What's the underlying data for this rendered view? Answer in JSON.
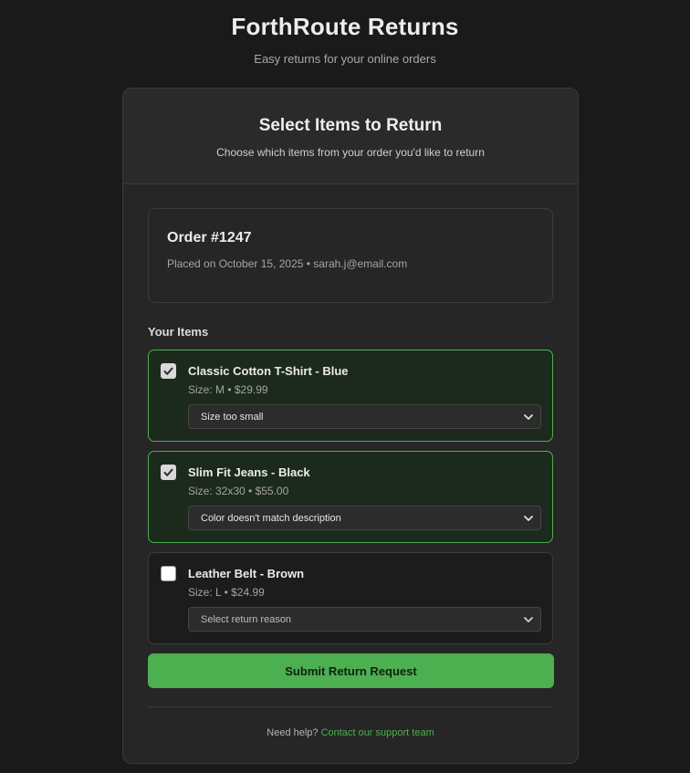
{
  "header": {
    "title": "ForthRoute Returns",
    "tagline": "Easy returns for your online orders"
  },
  "card": {
    "title": "Select Items to Return",
    "subtitle": "Choose which items from your order you'd like to return"
  },
  "order": {
    "number": "Order #1247",
    "meta": "Placed on October 15, 2025 • sarah.j@email.com"
  },
  "items_label": "Your Items",
  "items": [
    {
      "name": "Classic Cotton T-Shirt - Blue",
      "meta": "Size: M • $29.99",
      "checked": true,
      "reason": "Size too small"
    },
    {
      "name": "Slim Fit Jeans - Black",
      "meta": "Size: 32x30 • $55.00",
      "checked": true,
      "reason": "Color doesn't match description"
    },
    {
      "name": "Leather Belt - Brown",
      "meta": "Size: L • $24.99",
      "checked": false,
      "reason": "Select return reason"
    }
  ],
  "submit_label": "Submit Return Request",
  "help": {
    "prefix": "Need help?",
    "link_text": "Contact our support team"
  },
  "colors": {
    "accent": "#4caf50",
    "background": "#1a1a1a",
    "card": "#262626"
  },
  "icons": {
    "check": "check-icon",
    "chevron": "chevron-down-icon"
  }
}
